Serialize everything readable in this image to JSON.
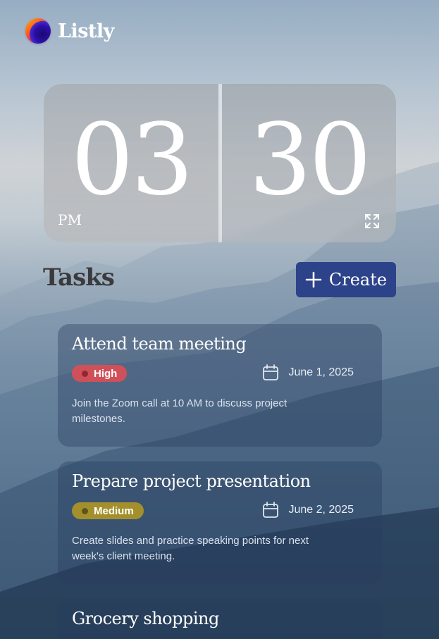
{
  "brand": {
    "name": "Listly",
    "logo_icon": "gradient-orb-logo"
  },
  "clock": {
    "hours": "03",
    "minutes": "30",
    "period": "PM",
    "expand_icon": "expand-icon"
  },
  "tasks": {
    "heading": "Tasks",
    "create_label": "Create",
    "items": [
      {
        "title": "Attend team meeting",
        "priority": "High",
        "priority_color": "#d0505a",
        "date": "June 1, 2025",
        "description": "Join the Zoom call at 10 AM to discuss project milestones."
      },
      {
        "title": "Prepare project presentation",
        "priority": "Medium",
        "priority_color": "#a3902c",
        "date": "June 2, 2025",
        "description": "Create slides and practice speaking points for next week's client meeting."
      },
      {
        "title": "Grocery shopping"
      }
    ]
  },
  "colors": {
    "accent": "#2c4389",
    "text_dark": "#3a3a3c"
  }
}
